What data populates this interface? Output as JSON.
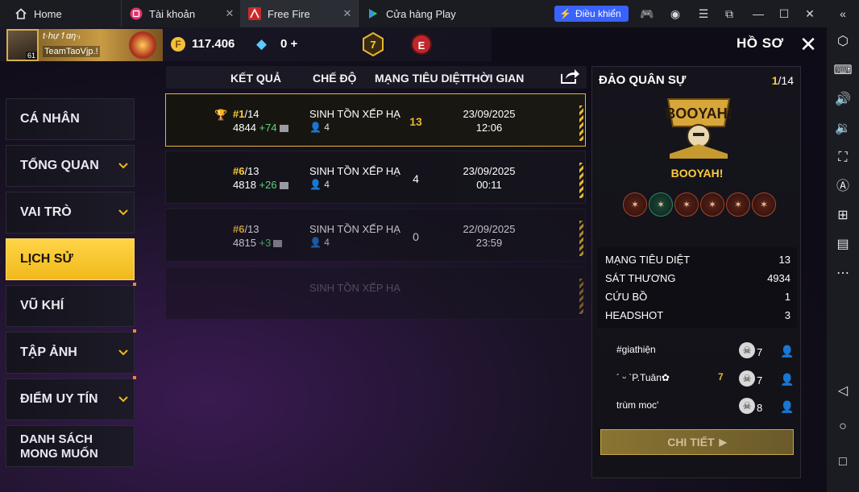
{
  "tabs": [
    {
      "label": "Home"
    },
    {
      "label": "Tài khoản"
    },
    {
      "label": "Free Fire"
    },
    {
      "label": "Cửa hàng Play"
    }
  ],
  "toolbar": {
    "control_label": "Điều khiển"
  },
  "profile": {
    "name": "t·hự↿ɑη·ᵢ",
    "guild": "TeamTaoVjp.!",
    "level": "61",
    "gold": "117.406",
    "diamonds": "0",
    "diamond_plus": "+",
    "rank_number": "7",
    "badge_letter": "E",
    "section_title": "HỒ SƠ"
  },
  "menu": [
    {
      "label": "CÁ NHÂN"
    },
    {
      "label": "TỔNG QUAN"
    },
    {
      "label": "VAI TRÒ"
    },
    {
      "label": "LỊCH SỬ"
    },
    {
      "label": "VŨ KHÍ"
    },
    {
      "label": "TẬP ẢNH"
    },
    {
      "label": "ĐIỂM UY TÍN"
    },
    {
      "label": "DANH SÁCH",
      "label2": "MONG MUỐN"
    }
  ],
  "table": {
    "headers": {
      "result": "KẾT QUẢ",
      "mode": "CHẾ ĐỘ",
      "kills": "MẠNG TIÊU DIỆT",
      "time": "THỜI GIAN"
    },
    "rows": [
      {
        "rank": "#1",
        "total": "/14",
        "points": "4844",
        "delta": "+74",
        "mode": "SINH TỒN XẾP HẠ",
        "team": "4",
        "kills": "13",
        "date": "23/09/2025",
        "time": "12:06"
      },
      {
        "rank": "#6",
        "total": "/13",
        "points": "4818",
        "delta": "+26",
        "mode": "SINH TỒN XẾP HẠ",
        "team": "4",
        "kills": "4",
        "date": "23/09/2025",
        "time": "00:11"
      },
      {
        "rank": "#6",
        "total": "/13",
        "points": "4815",
        "delta": "+3",
        "mode": "SINH TỒN XẾP HẠ",
        "team": "4",
        "kills": "0",
        "date": "22/09/2025",
        "time": "23:59"
      },
      {
        "mode": "SINH TỒN XẾP HẠ"
      }
    ]
  },
  "detail": {
    "map": "ĐẢO QUÂN SỰ",
    "index": "1",
    "index_total": "/14",
    "booyah_logo": "BOOYAH!",
    "booyah": "BOOYAH!",
    "stats": [
      {
        "label": "MẠNG TIÊU DIỆT",
        "value": "13"
      },
      {
        "label": "SÁT THƯƠNG",
        "value": "4934"
      },
      {
        "label": "CỨU BỒ",
        "value": "1"
      },
      {
        "label": "HEADSHOT",
        "value": "3"
      }
    ],
    "players": [
      {
        "name": "#giathiện",
        "kills": "7"
      },
      {
        "name": "´ ᵕ `P.Tuân✿",
        "kills": "7"
      },
      {
        "name": "trùm moc'",
        "kills": "8"
      }
    ],
    "detail_button": "CHI TIẾT"
  }
}
